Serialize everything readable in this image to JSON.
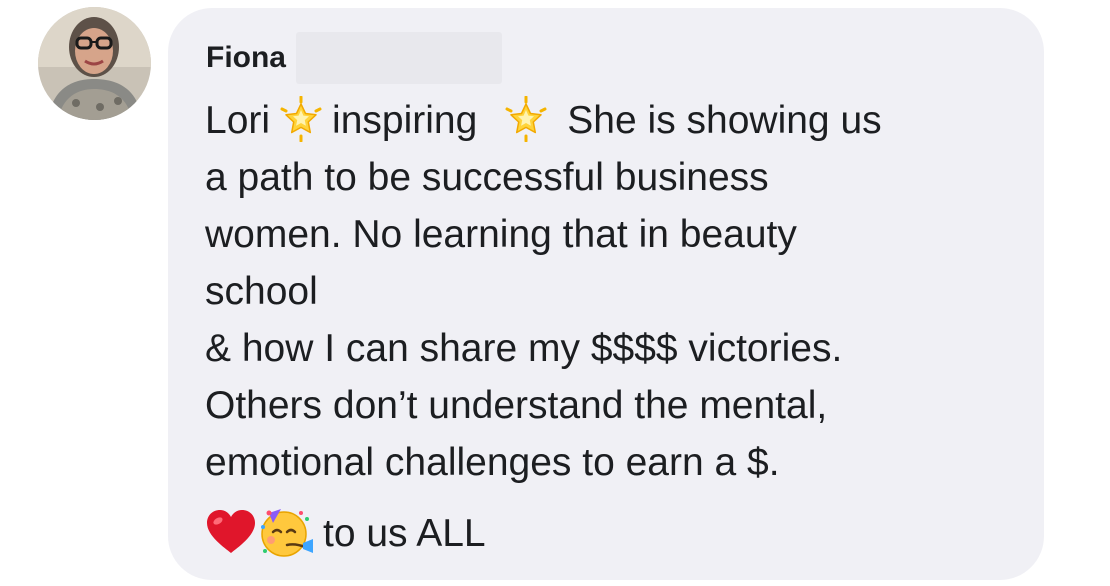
{
  "comment": {
    "author": {
      "name": "Fiona",
      "avatar_icon": "profile-photo-avatar",
      "surname_redacted": true
    },
    "text": {
      "line1_a": "Lori",
      "line1_b": "inspiring",
      "line1_c": "She is showing us",
      "line2": "a path to be successful business",
      "line3": "women.  No learning that in beauty",
      "line4": "school",
      "line5": "& how I can share my $$$$ victories.",
      "line6": "Others don’t understand the mental,",
      "line7": "emotional challenges to earn a $.",
      "closing": "to us ALL"
    },
    "emojis": {
      "star": "glowing-star-icon",
      "heart": "red-heart-icon",
      "party_face": "partying-face-icon"
    }
  },
  "colors": {
    "bubble_background": "#f0f0f5",
    "text": "#1c1e21",
    "redaction": "#e8e8ed"
  }
}
